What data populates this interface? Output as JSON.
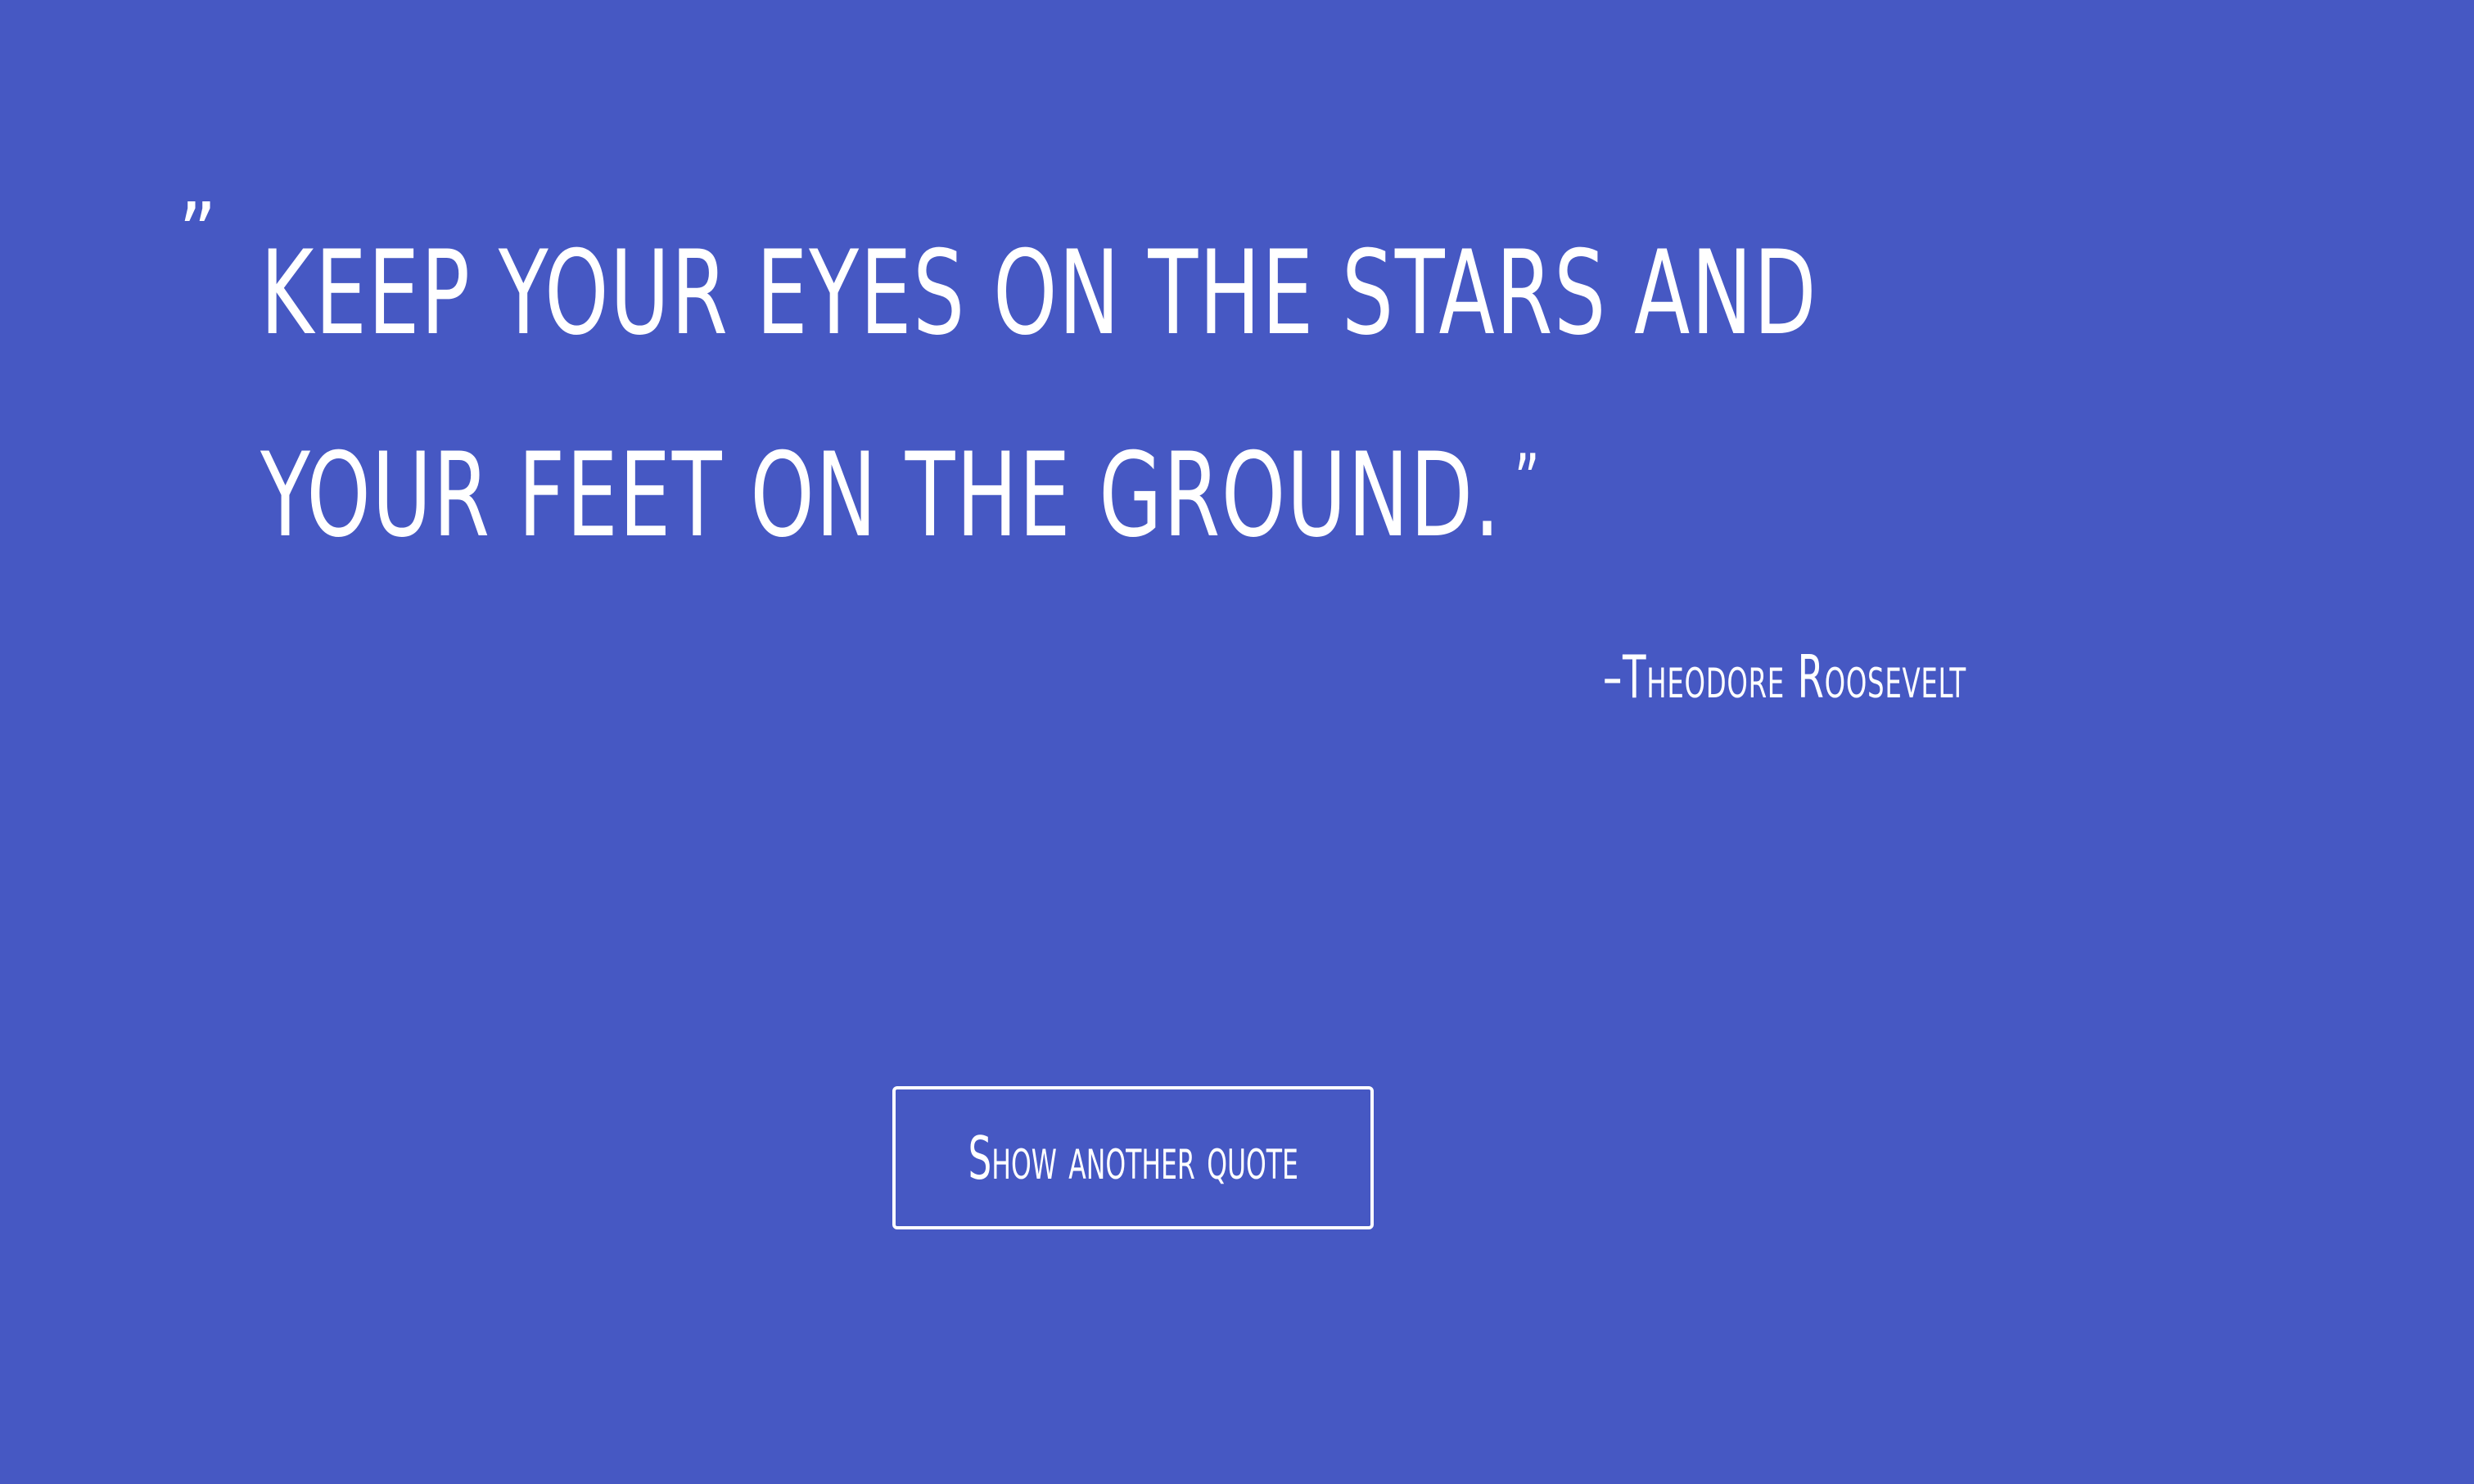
{
  "quote": {
    "open_mark": "”",
    "text": "Keep your eyes on the stars and your feet on the ground.",
    "close_mark": "”"
  },
  "author": "–Theodore Roosevelt",
  "button": {
    "label": "Show another quote"
  },
  "colors": {
    "background": "#4658c3",
    "text": "#ffffff"
  }
}
